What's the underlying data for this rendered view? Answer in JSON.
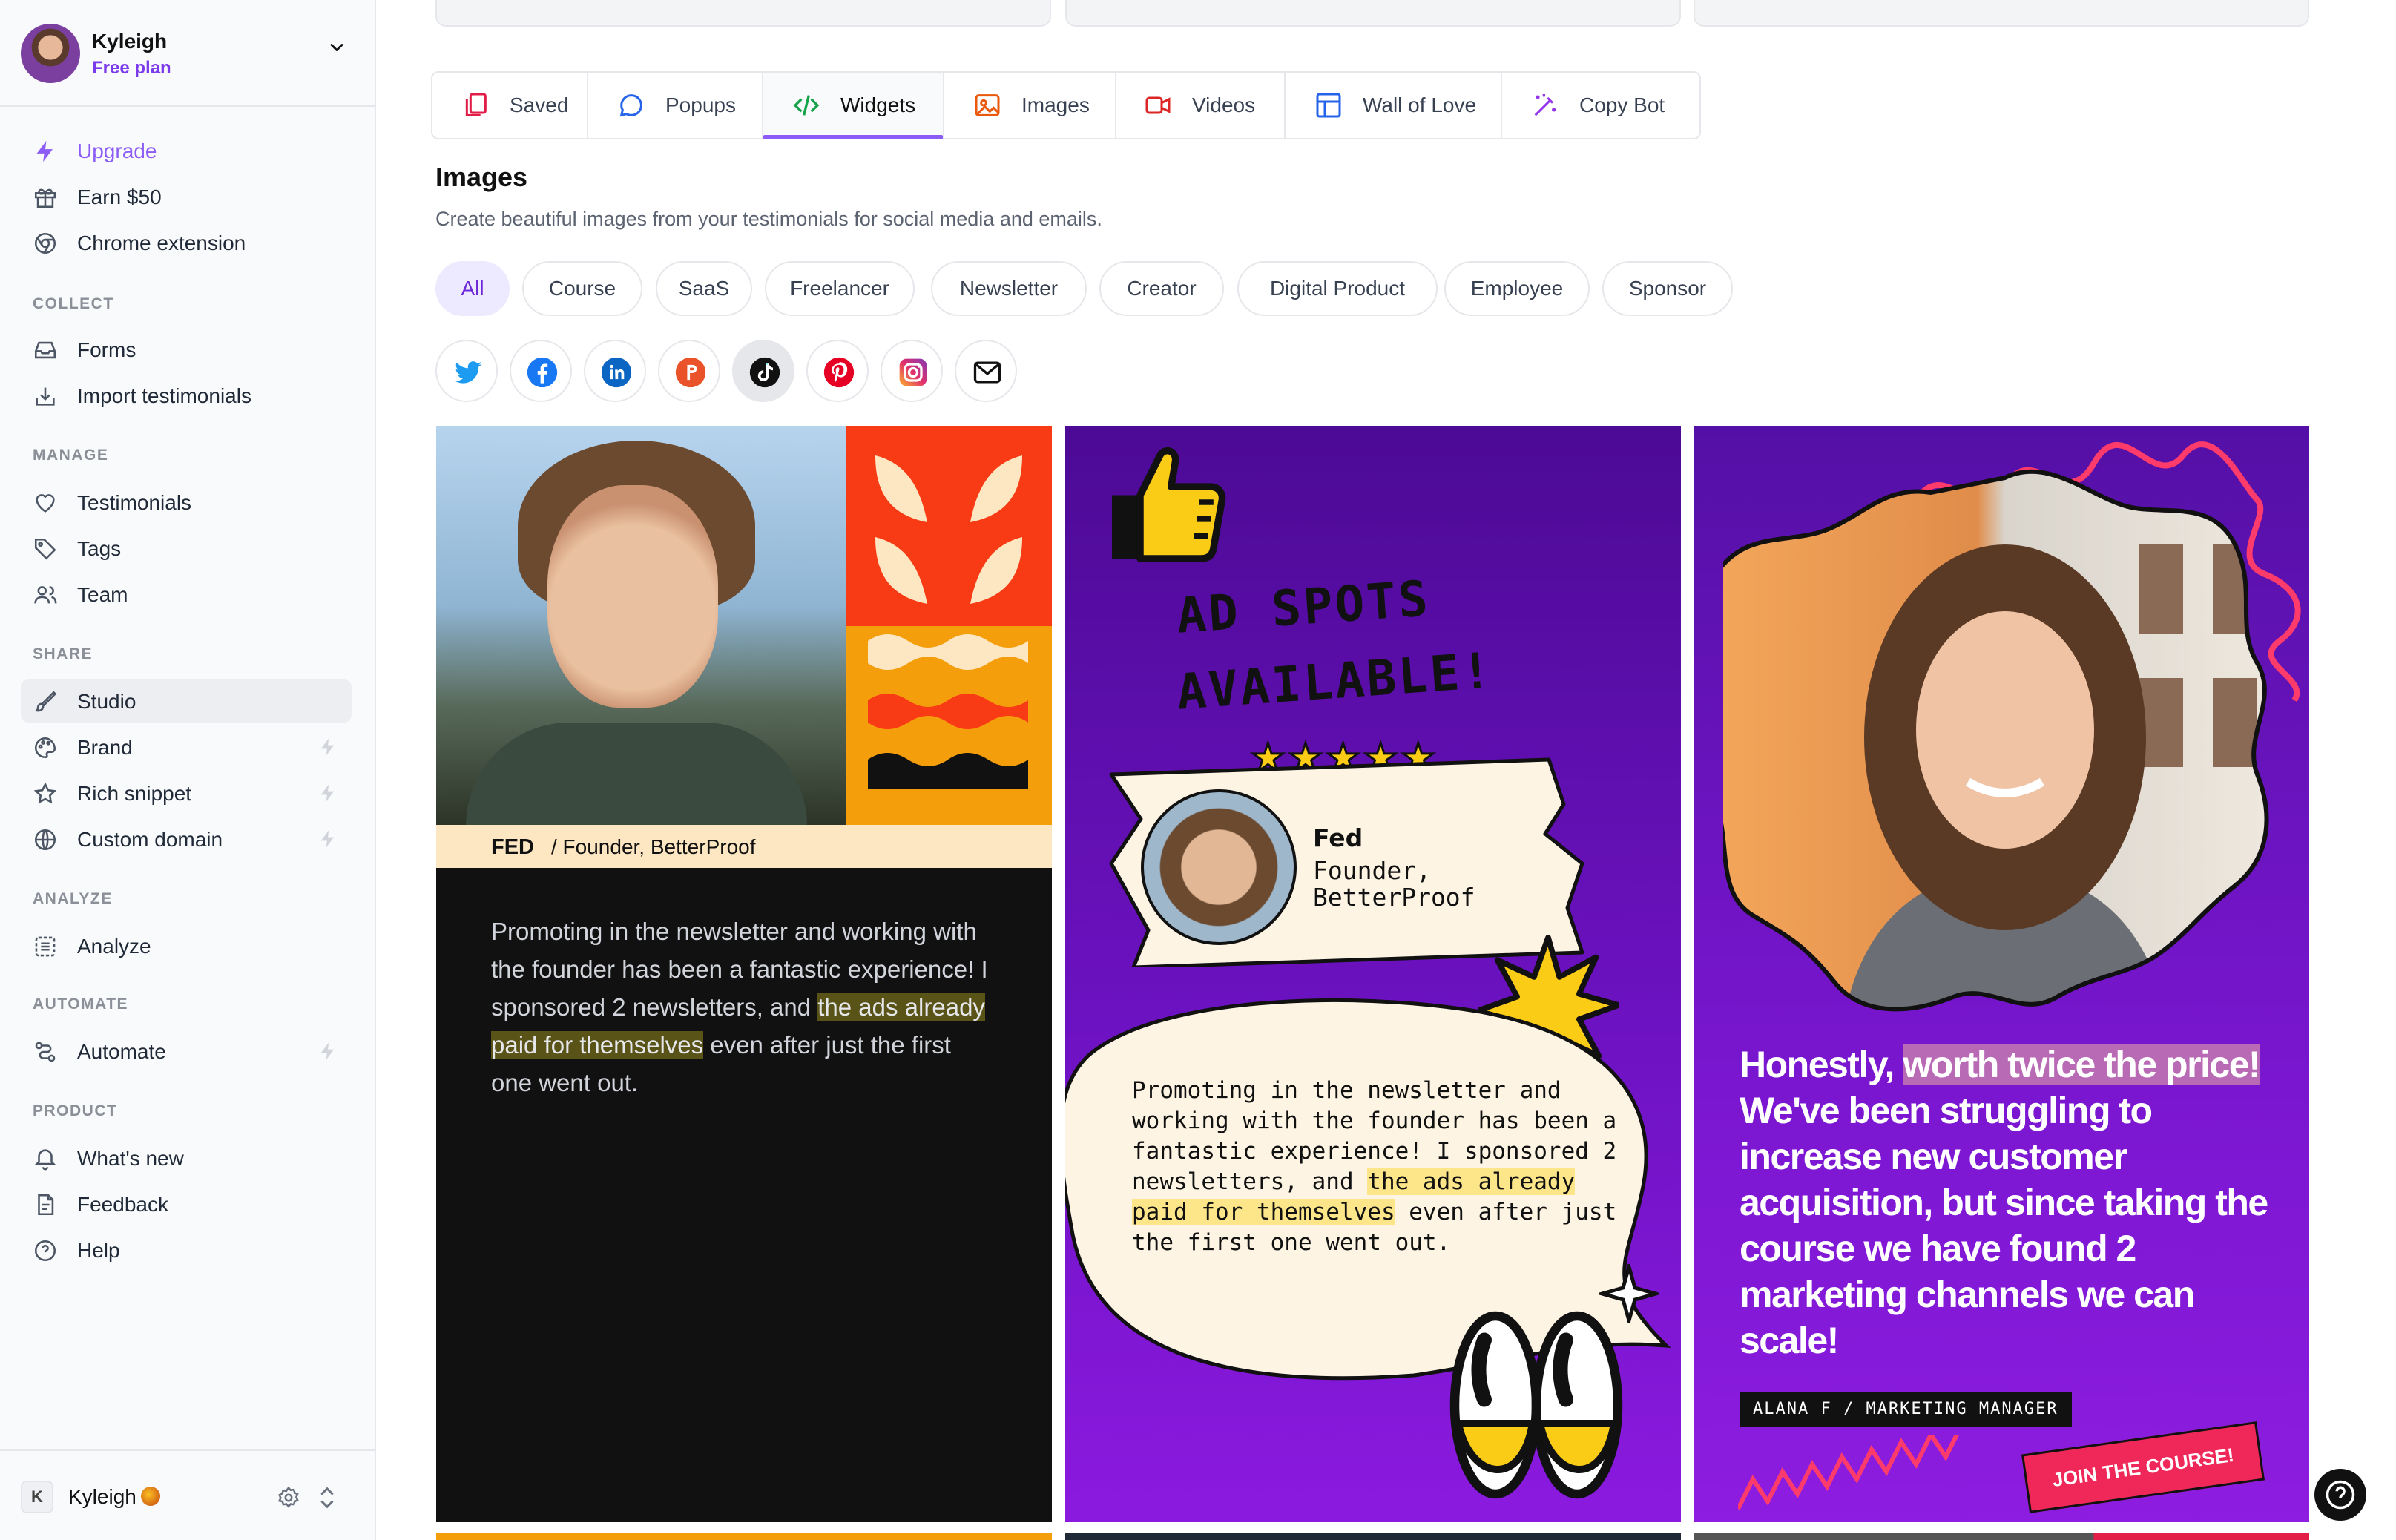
{
  "user": {
    "name": "Kyleigh",
    "plan": "Free plan"
  },
  "sidebar": {
    "top_items": [
      {
        "label": "Upgrade",
        "icon": "bolt-icon"
      },
      {
        "label": "Earn $50",
        "icon": "gift-icon"
      },
      {
        "label": "Chrome extension",
        "icon": "chrome-icon"
      }
    ],
    "sections": [
      {
        "title": "COLLECT",
        "items": [
          {
            "label": "Forms",
            "icon": "inbox-icon"
          },
          {
            "label": "Import testimonials",
            "icon": "import-icon"
          }
        ]
      },
      {
        "title": "MANAGE",
        "items": [
          {
            "label": "Testimonials",
            "icon": "heart-icon"
          },
          {
            "label": "Tags",
            "icon": "tag-icon"
          },
          {
            "label": "Team",
            "icon": "users-icon"
          }
        ]
      },
      {
        "title": "SHARE",
        "items": [
          {
            "label": "Studio",
            "icon": "brush-icon"
          },
          {
            "label": "Brand",
            "icon": "palette-icon"
          },
          {
            "label": "Rich snippet",
            "icon": "star-icon"
          },
          {
            "label": "Custom domain",
            "icon": "globe-icon"
          }
        ]
      },
      {
        "title": "ANALYZE",
        "items": [
          {
            "label": "Analyze",
            "icon": "list-icon"
          }
        ]
      },
      {
        "title": "AUTOMATE",
        "items": [
          {
            "label": "Automate",
            "icon": "flow-icon"
          }
        ]
      },
      {
        "title": "PRODUCT",
        "items": [
          {
            "label": "What's new",
            "icon": "bell-icon"
          },
          {
            "label": "Feedback",
            "icon": "feedback-icon"
          },
          {
            "label": "Help",
            "icon": "help-icon"
          }
        ]
      }
    ],
    "active_item": "Studio",
    "bottom": {
      "name": "Kyleigh",
      "initial": "K"
    }
  },
  "tabs": [
    {
      "label": "Saved",
      "icon": "copy-icon",
      "color": "#e11d48"
    },
    {
      "label": "Popups",
      "icon": "chat-icon",
      "color": "#2563eb"
    },
    {
      "label": "Widgets",
      "icon": "code-icon",
      "color": "#16a34a"
    },
    {
      "label": "Images",
      "icon": "image-icon",
      "color": "#ea580c"
    },
    {
      "label": "Videos",
      "icon": "video-icon",
      "color": "#dc2626"
    },
    {
      "label": "Wall of Love",
      "icon": "layout-icon",
      "color": "#2563eb"
    },
    {
      "label": "Copy Bot",
      "icon": "wand-icon",
      "color": "#9333ea"
    }
  ],
  "active_tab": "Widgets",
  "page": {
    "title": "Images",
    "subtitle": "Create beautiful images from your testimonials for social media and emails."
  },
  "filters": [
    "All",
    "Course",
    "SaaS",
    "Freelancer",
    "Newsletter",
    "Creator",
    "Digital Product",
    "Employee",
    "Sponsor"
  ],
  "active_filter": "All",
  "socials": [
    "twitter-icon",
    "facebook-icon",
    "linkedin-icon",
    "producthunt-icon",
    "tiktok-icon",
    "pinterest-icon",
    "instagram-icon",
    "email-icon"
  ],
  "cards": {
    "card1": {
      "name": "FED",
      "role": "/ Founder, BetterProof",
      "quote_a": "Promoting in the newsletter and working with the founder has been a fantastic experience! I sponsored 2 newsletters, and ",
      "quote_hl": "the ads already paid for themselves",
      "quote_b": " even after just the first one went out."
    },
    "card2": {
      "heading1": "AD SPOTS",
      "heading2": "AVAILABLE!",
      "stars": "★★★★★",
      "name": "Fed",
      "role": "Founder, BetterProof",
      "quote_a": "Promoting in the newsletter and working with the founder has been a fantastic experience! I sponsored 2 newsletters, and ",
      "quote_hl": "the ads already paid for themselves",
      "quote_b": " even after just the first one went out."
    },
    "card3": {
      "text_a": "Honestly, ",
      "text_hl": "worth twice the price!",
      "text_b": " We've been struggling to increase new customer acquisition, but since taking the course we have found 2 marketing channels we can scale!",
      "tag": "ALANA F / MARKETING MANAGER",
      "cta": "JOIN THE COURSE!"
    }
  },
  "colors": {
    "accent": "#8b5cf6",
    "upgrade": "#8b5cf6",
    "plan": "#7c3aed"
  }
}
